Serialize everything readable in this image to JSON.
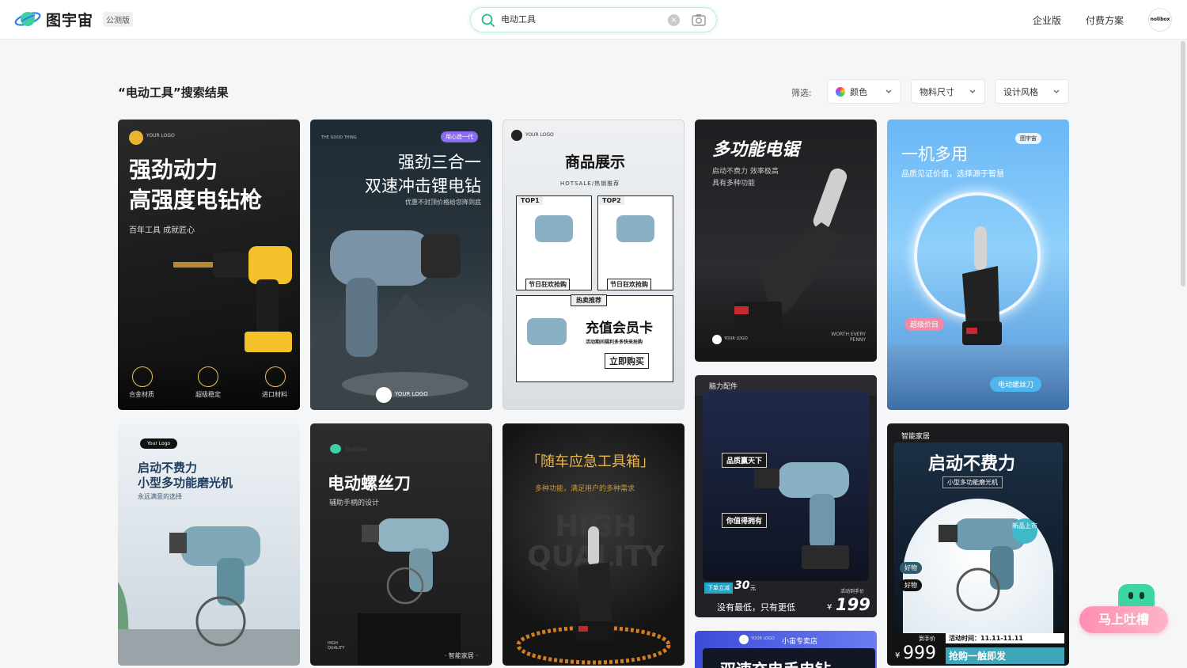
{
  "header": {
    "brand": "图宇宙",
    "beta_badge": "公测版",
    "search_value": "电动工具",
    "nav": [
      "企业版",
      "付费方案"
    ],
    "avatar_text": "nolibox"
  },
  "results": {
    "title": "“电动工具”搜索结果",
    "filter_label": "筛选:",
    "filters": [
      "颜色",
      "物料尺寸",
      "设计风格"
    ]
  },
  "cards": {
    "c1": {
      "logo": "YOUR LOGO",
      "title1": "强劲动力",
      "title2": "高强度电钻枪",
      "sub": "百年工具 成就匠心",
      "features": [
        "合金材质",
        "超级稳定",
        "进口材料"
      ]
    },
    "c2": {
      "tag": "THE GOOD THING",
      "badge": "用心造一代",
      "title1": "强劲三合一",
      "title2": "双速冲击锂电钻",
      "sub": "优惠不封顶价格给您降到底",
      "logo": "YOUR LOGO"
    },
    "c3": {
      "logo": "YOUR LOGO",
      "title": "商品展示",
      "sub": "HOTSALE/热销推荐",
      "top1": "TOP1",
      "top2": "TOP2",
      "label1": "节日狂欢抢购",
      "label2": "节日狂欢抢购",
      "hot": "热卖推荐",
      "vip": "充值会员卡",
      "vip_sub": "活动期间福利多多快来抢购",
      "buy": "立即购买"
    },
    "c4": {
      "title": "多功能电锯",
      "sub1": "启动不费力 效率极高",
      "sub2": "具有多种功能",
      "footer": "WORTH EVERY PENNY",
      "logo": "YOUR LOGO"
    },
    "c5": {
      "title": "一机多用",
      "sub": "品质见证价值，选择源于智慧",
      "logo": "图宇宙",
      "price_tag": "超级价目",
      "product": "电动螺丝刀"
    },
    "c6": {
      "logo": "Your Logo",
      "title1": "启动不费力",
      "title2": "小型多功能磨光机",
      "sub": "永远满意的选择"
    },
    "c7": {
      "brand": "Nolibox",
      "title": "电动螺丝刀",
      "sub": "辅助手柄的设计",
      "foot_left": "HIGH QUALITY",
      "foot_right": "· 智能家居 ·"
    },
    "c8": {
      "title": "「随车应急工具箱」",
      "sub": "多种功能，满足用户的多种需求",
      "bg": "HIGH QUALITY"
    },
    "c9": {
      "tag": "脑力配件",
      "label1": "品质赢天下",
      "label2": "你值得拥有",
      "discount": "下单立减",
      "discount_value": "30",
      "discount_unit": "元",
      "slogan": "没有最低，只有更低",
      "price_label": "活动到手价",
      "price_currency": "¥",
      "price": "199"
    },
    "c10": {
      "tag": "智能家居",
      "title": "启动不费力",
      "sub": "小型多功能磨光机",
      "new": "新品上市",
      "good1": "好物",
      "good2": "好物",
      "price_label": "到手价",
      "price_currency": "¥",
      "price": "999",
      "date": "活动时间：11.11-11.11",
      "cta": "抢购一触即发"
    },
    "c11": {
      "logo": "YOUR LOGO",
      "store": "小宙专卖店",
      "title": "双速充电手电钻"
    }
  },
  "feedback": "马上吐槽"
}
